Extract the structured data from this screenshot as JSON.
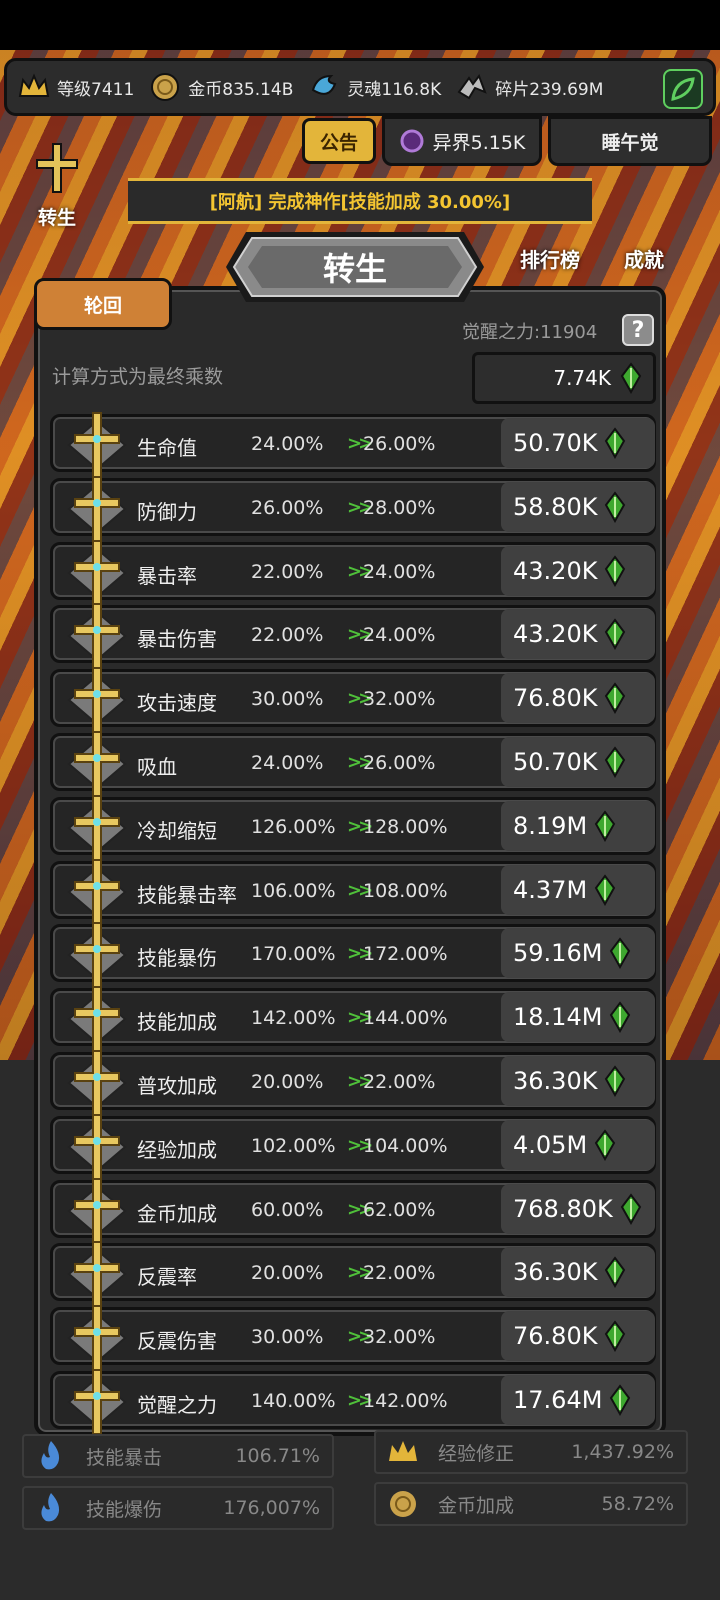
{
  "topbar": {
    "level": "等级7411",
    "gold": "金币835.14B",
    "soul": "灵魂116.8K",
    "fragments": "碎片239.69M"
  },
  "buttons": {
    "notice": "公告",
    "otherworld": "异界5.15K",
    "nap": "睡午觉",
    "side_rebirth": "转生",
    "ranking": "排行榜",
    "achievement": "成就"
  },
  "announcement": "[阿航] 完成神作[技能加成 30.00%]",
  "dialog": {
    "title": "转生",
    "tab": "轮回",
    "awaken_power": "觉醒之力:11904",
    "help": "?",
    "calc_note": "计算方式为最终乘数",
    "total": "7.74K"
  },
  "rows": [
    {
      "name": "生命值",
      "from": "24.00%",
      "to": "26.00%",
      "cost": "50.70K"
    },
    {
      "name": "防御力",
      "from": "26.00%",
      "to": "28.00%",
      "cost": "58.80K"
    },
    {
      "name": "暴击率",
      "from": "22.00%",
      "to": "24.00%",
      "cost": "43.20K"
    },
    {
      "name": "暴击伤害",
      "from": "22.00%",
      "to": "24.00%",
      "cost": "43.20K"
    },
    {
      "name": "攻击速度",
      "from": "30.00%",
      "to": "32.00%",
      "cost": "76.80K"
    },
    {
      "name": "吸血",
      "from": "24.00%",
      "to": "26.00%",
      "cost": "50.70K"
    },
    {
      "name": "冷却缩短",
      "from": "126.00%",
      "to": "128.00%",
      "cost": "8.19M"
    },
    {
      "name": "技能暴击率",
      "from": "106.00%",
      "to": "108.00%",
      "cost": "4.37M"
    },
    {
      "name": "技能暴伤",
      "from": "170.00%",
      "to": "172.00%",
      "cost": "59.16M"
    },
    {
      "name": "技能加成",
      "from": "142.00%",
      "to": "144.00%",
      "cost": "18.14M"
    },
    {
      "name": "普攻加成",
      "from": "20.00%",
      "to": "22.00%",
      "cost": "36.30K"
    },
    {
      "name": "经验加成",
      "from": "102.00%",
      "to": "104.00%",
      "cost": "4.05M"
    },
    {
      "name": "金币加成",
      "from": "60.00%",
      "to": "62.00%",
      "cost": "768.80K"
    },
    {
      "name": "反震率",
      "from": "20.00%",
      "to": "22.00%",
      "cost": "36.30K"
    },
    {
      "name": "反震伤害",
      "from": "30.00%",
      "to": "32.00%",
      "cost": "76.80K"
    },
    {
      "name": "觉醒之力",
      "from": "140.00%",
      "to": "142.00%",
      "cost": "17.64M"
    }
  ],
  "arrow": ">>",
  "bottom_stats": [
    {
      "label": "技能暴击",
      "value": "106.71%"
    },
    {
      "label": "经验修正",
      "value": "1,437.92%"
    },
    {
      "label": "技能爆伤",
      "value": "176,007%"
    },
    {
      "label": "金币加成",
      "value": "58.72%"
    }
  ],
  "colors": {
    "accent_gold": "#e3b53a",
    "tab_orange": "#cf8136",
    "gem_green": "#4fbf3a",
    "panel": "#2a2a2a"
  }
}
